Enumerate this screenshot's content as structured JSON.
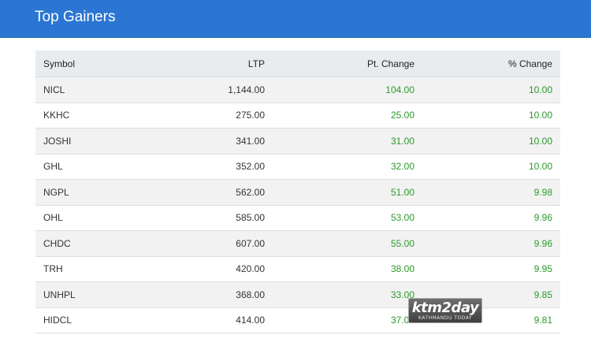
{
  "header": {
    "title": "Top Gainers"
  },
  "table": {
    "columns": [
      "Symbol",
      "LTP",
      "Pt. Change",
      "% Change"
    ],
    "rows": [
      {
        "symbol": "NICL",
        "ltp": "1,144.00",
        "pt_change": "104.00",
        "pct_change": "10.00"
      },
      {
        "symbol": "KKHC",
        "ltp": "275.00",
        "pt_change": "25.00",
        "pct_change": "10.00"
      },
      {
        "symbol": "JOSHI",
        "ltp": "341.00",
        "pt_change": "31.00",
        "pct_change": "10.00"
      },
      {
        "symbol": "GHL",
        "ltp": "352.00",
        "pt_change": "32.00",
        "pct_change": "10.00"
      },
      {
        "symbol": "NGPL",
        "ltp": "562.00",
        "pt_change": "51.00",
        "pct_change": "9.98"
      },
      {
        "symbol": "OHL",
        "ltp": "585.00",
        "pt_change": "53.00",
        "pct_change": "9.96"
      },
      {
        "symbol": "CHDC",
        "ltp": "607.00",
        "pt_change": "55.00",
        "pct_change": "9.96"
      },
      {
        "symbol": "TRH",
        "ltp": "420.00",
        "pt_change": "38.00",
        "pct_change": "9.95"
      },
      {
        "symbol": "UNHPL",
        "ltp": "368.00",
        "pt_change": "33.00",
        "pct_change": "9.85"
      },
      {
        "symbol": "HIDCL",
        "ltp": "414.00",
        "pt_change": "37.00",
        "pct_change": "9.81"
      }
    ]
  },
  "watermark": {
    "main": "ktm2day",
    "sub": "KATHMANDU TODAY"
  },
  "colors": {
    "header_bg": "#2a76d2",
    "gain_text": "#2b9a2b",
    "row_alt": "#f2f2f2"
  }
}
